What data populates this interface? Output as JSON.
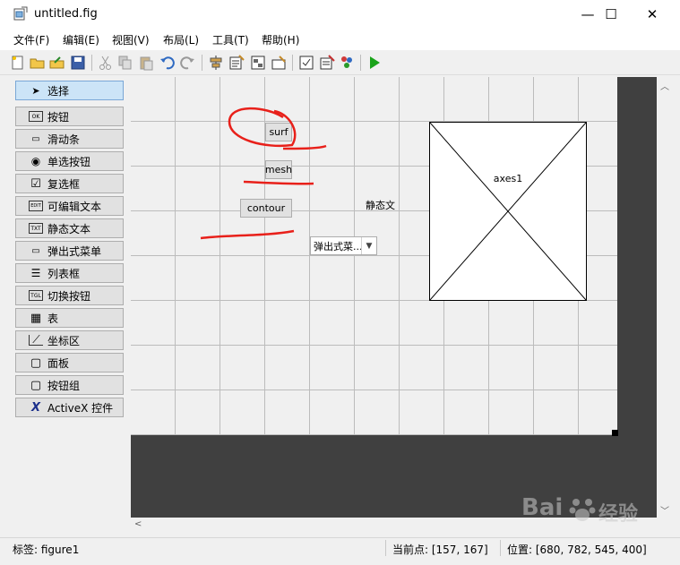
{
  "window": {
    "title": "untitled.fig"
  },
  "window_controls": {
    "minimize": "—",
    "maximize": "☐",
    "close": "✕"
  },
  "menu": [
    {
      "label": "文件(F)"
    },
    {
      "label": "编辑(E)"
    },
    {
      "label": "视图(V)"
    },
    {
      "label": "布局(L)"
    },
    {
      "label": "工具(T)"
    },
    {
      "label": "帮助(H)"
    }
  ],
  "toolbar": {
    "icons": [
      "new-file-icon",
      "open-folder-icon",
      "import-icon",
      "save-icon",
      "cut-icon",
      "copy-icon",
      "paste-icon",
      "undo-icon",
      "redo-icon",
      "align-icon",
      "menu-editor-icon",
      "tab-order-icon",
      "toolbar-editor-icon",
      "editor-icon",
      "property-inspector-icon",
      "object-browser-icon",
      "run-icon"
    ]
  },
  "palette": [
    {
      "label": "选择",
      "icon": "pointer-icon",
      "glyph": "➤",
      "selected": true
    },
    {
      "label": "按钮",
      "icon": "pushbutton-icon",
      "glyph": "OK"
    },
    {
      "label": "滑动条",
      "icon": "slider-icon",
      "glyph": "▭"
    },
    {
      "label": "单选按钮",
      "icon": "radio-icon",
      "glyph": "◉"
    },
    {
      "label": "复选框",
      "icon": "checkbox-icon",
      "glyph": "☑"
    },
    {
      "label": "可编辑文本",
      "icon": "edit-text-icon",
      "glyph": "EDIT"
    },
    {
      "label": "静态文本",
      "icon": "static-text-icon",
      "glyph": "TXT"
    },
    {
      "label": "弹出式菜单",
      "icon": "popup-menu-icon",
      "glyph": "▭"
    },
    {
      "label": "列表框",
      "icon": "listbox-icon",
      "glyph": "☰"
    },
    {
      "label": "切换按钮",
      "icon": "toggle-button-icon",
      "glyph": "TGL"
    },
    {
      "label": "表",
      "icon": "table-icon",
      "glyph": "▦"
    },
    {
      "label": "坐标区",
      "icon": "axes-icon",
      "glyph": "⟋"
    },
    {
      "label": "面板",
      "icon": "panel-icon",
      "glyph": "▢"
    },
    {
      "label": "按钮组",
      "icon": "button-group-icon",
      "glyph": "▢"
    },
    {
      "label": "ActiveX 控件",
      "icon": "activex-icon",
      "glyph": "X"
    }
  ],
  "canvas": {
    "buttons": [
      {
        "label": "surf"
      },
      {
        "label": "mesh"
      },
      {
        "label": "contour"
      }
    ],
    "static_text": "静态文",
    "popup_value": "弹出式菜...",
    "axes_label": "axes1"
  },
  "status": {
    "tag": "标签: figure1",
    "current_point": "当前点:  [157, 167]",
    "position": "位置: [680, 782, 545, 400]"
  },
  "watermark": {
    "text": "Bai",
    "text2": "经验"
  },
  "colors": {
    "annotation_red": "#e8201a",
    "selection_blue": "#cce4f7",
    "run_green": "#1aa31a"
  }
}
